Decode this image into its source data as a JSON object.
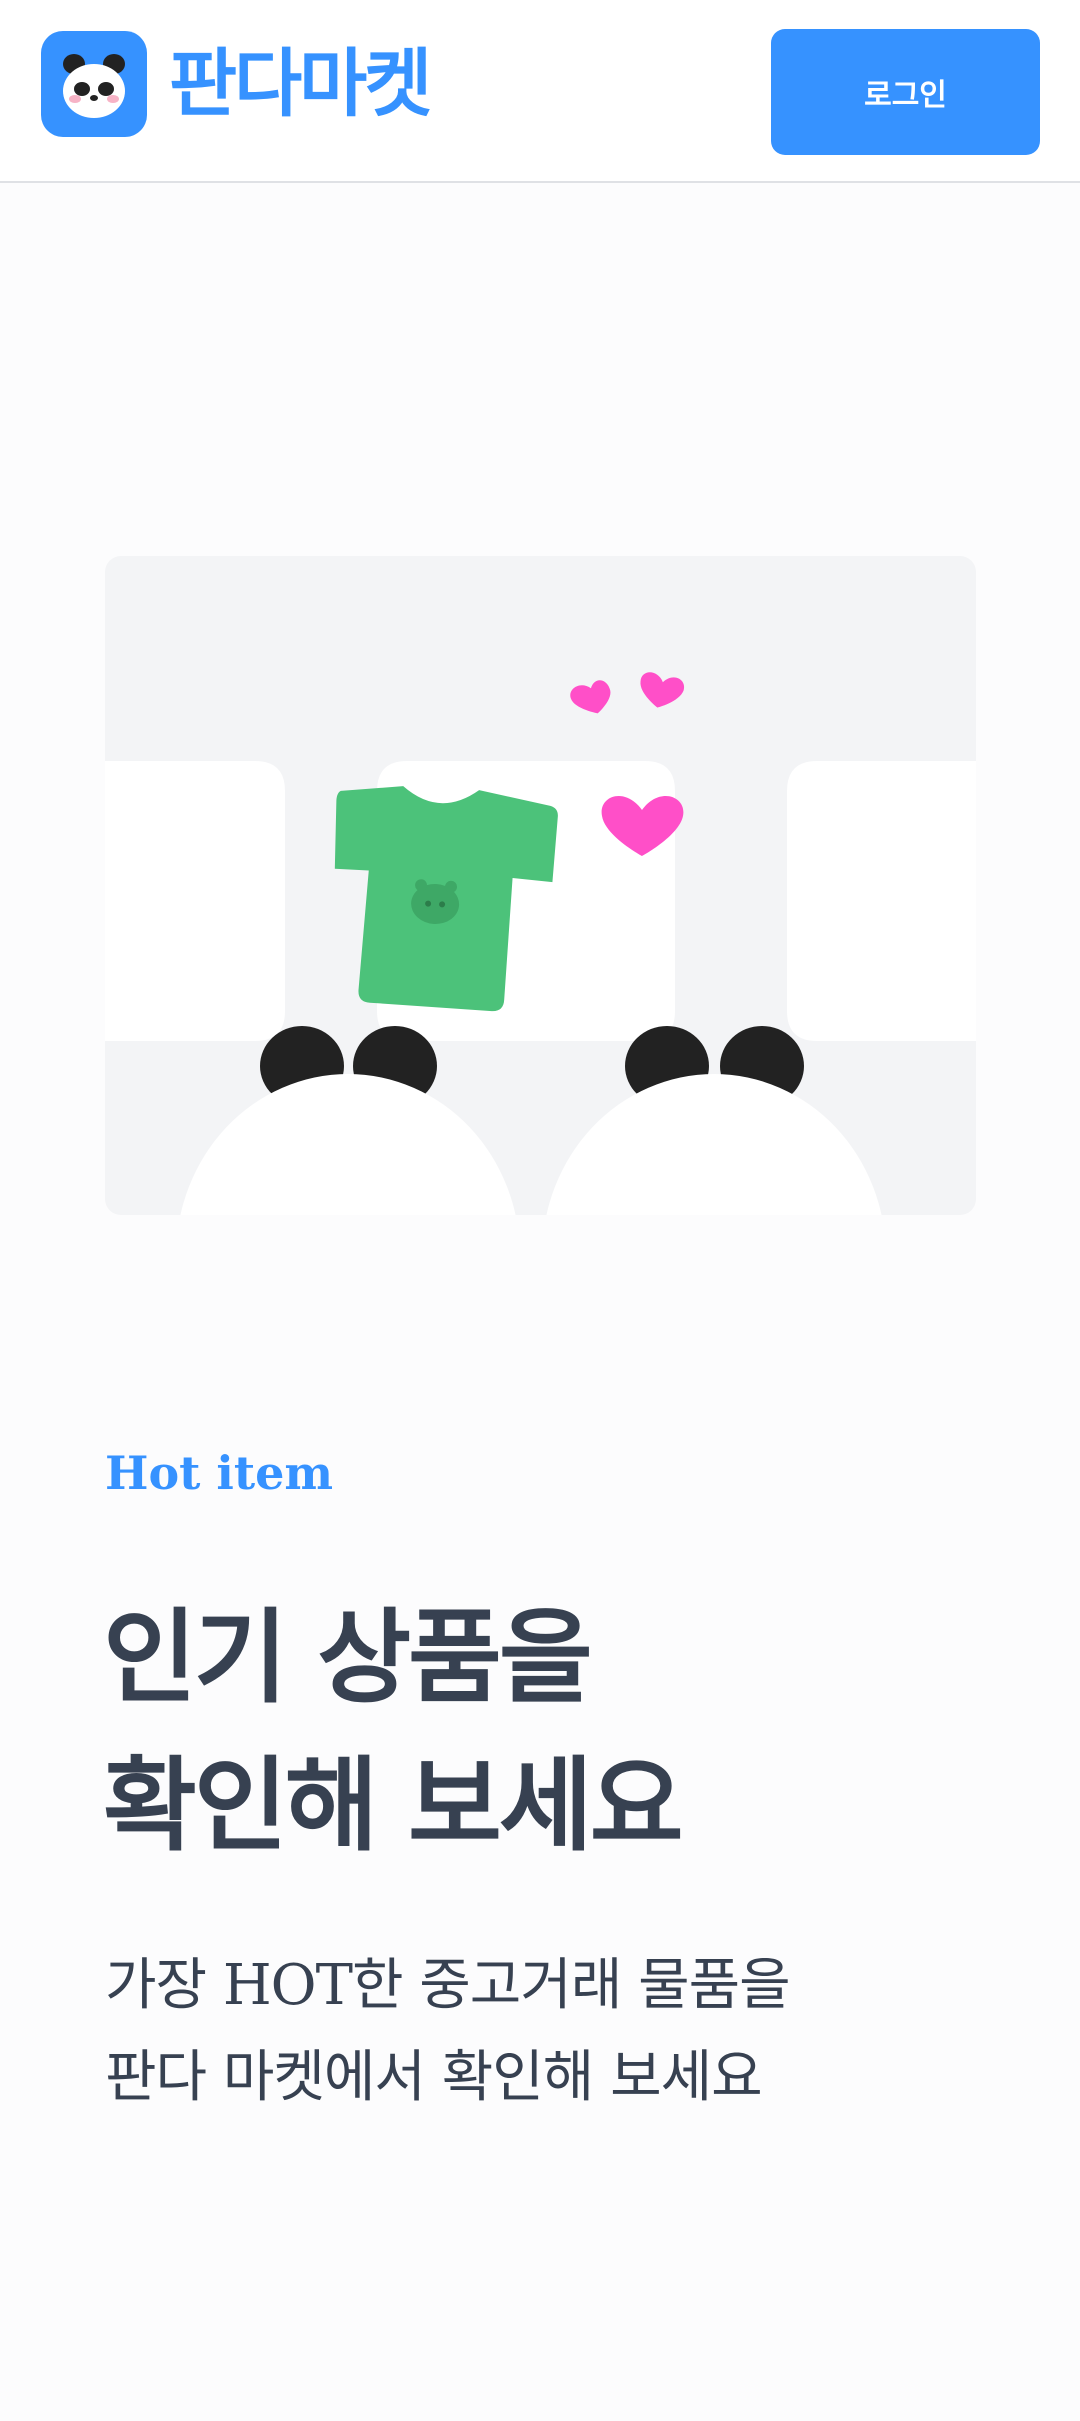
{
  "header": {
    "logo_text": "판다마켓",
    "login_label": "로그인"
  },
  "hero": {
    "tag": "Hot item",
    "title_lines": [
      "인기 상품을",
      "확인해 보세요"
    ],
    "description_lines": [
      "가장 HOT한 중고거래 물품을",
      "판다 마켓에서 확인해 보세요"
    ]
  },
  "colors": {
    "brand": "#3692ff",
    "text": "#374151",
    "tshirt": "#4cc27a",
    "heart": "#ff4fc8",
    "image_bg": "#f3f4f6"
  },
  "icons": [
    "panda-logo-icon",
    "tshirt-icon",
    "heart-icon",
    "panda-icon"
  ]
}
